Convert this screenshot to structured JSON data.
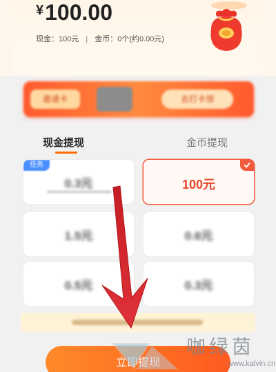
{
  "balance": {
    "currency_symbol": "¥",
    "amount": "100.00",
    "cash_label": "现金：100元",
    "separator": "|",
    "coin_label": "金币：0个(约0.00元)"
  },
  "promo": {
    "left_chip": "邀请卡",
    "right_chip": "去打卡领"
  },
  "tabs": [
    {
      "label": "现金提现",
      "active": true
    },
    {
      "label": "金币提现",
      "active": false
    }
  ],
  "options": [
    {
      "value": "0.3元",
      "tag": "任务",
      "selected": false,
      "blurred": true
    },
    {
      "value": "100元",
      "selected": true,
      "blurred": false
    },
    {
      "value": "1.5元",
      "selected": false,
      "blurred": true
    },
    {
      "value": "0.6元",
      "selected": false,
      "blurred": true
    },
    {
      "value": "0.5元",
      "selected": false,
      "blurred": true
    },
    {
      "value": "0.3元",
      "selected": false,
      "blurred": true
    }
  ],
  "withdraw_button": {
    "label": "立即提现"
  },
  "watermark": {
    "text": "咖绿茵",
    "url": "www.kalvin.cn"
  },
  "colors": {
    "accent": "#ff6a00",
    "selected_border": "#f25a3c",
    "selected_text": "#e8462a",
    "arrow": "#d9252b",
    "button_start": "#ff8a2a",
    "button_end": "#ff5a1f"
  }
}
